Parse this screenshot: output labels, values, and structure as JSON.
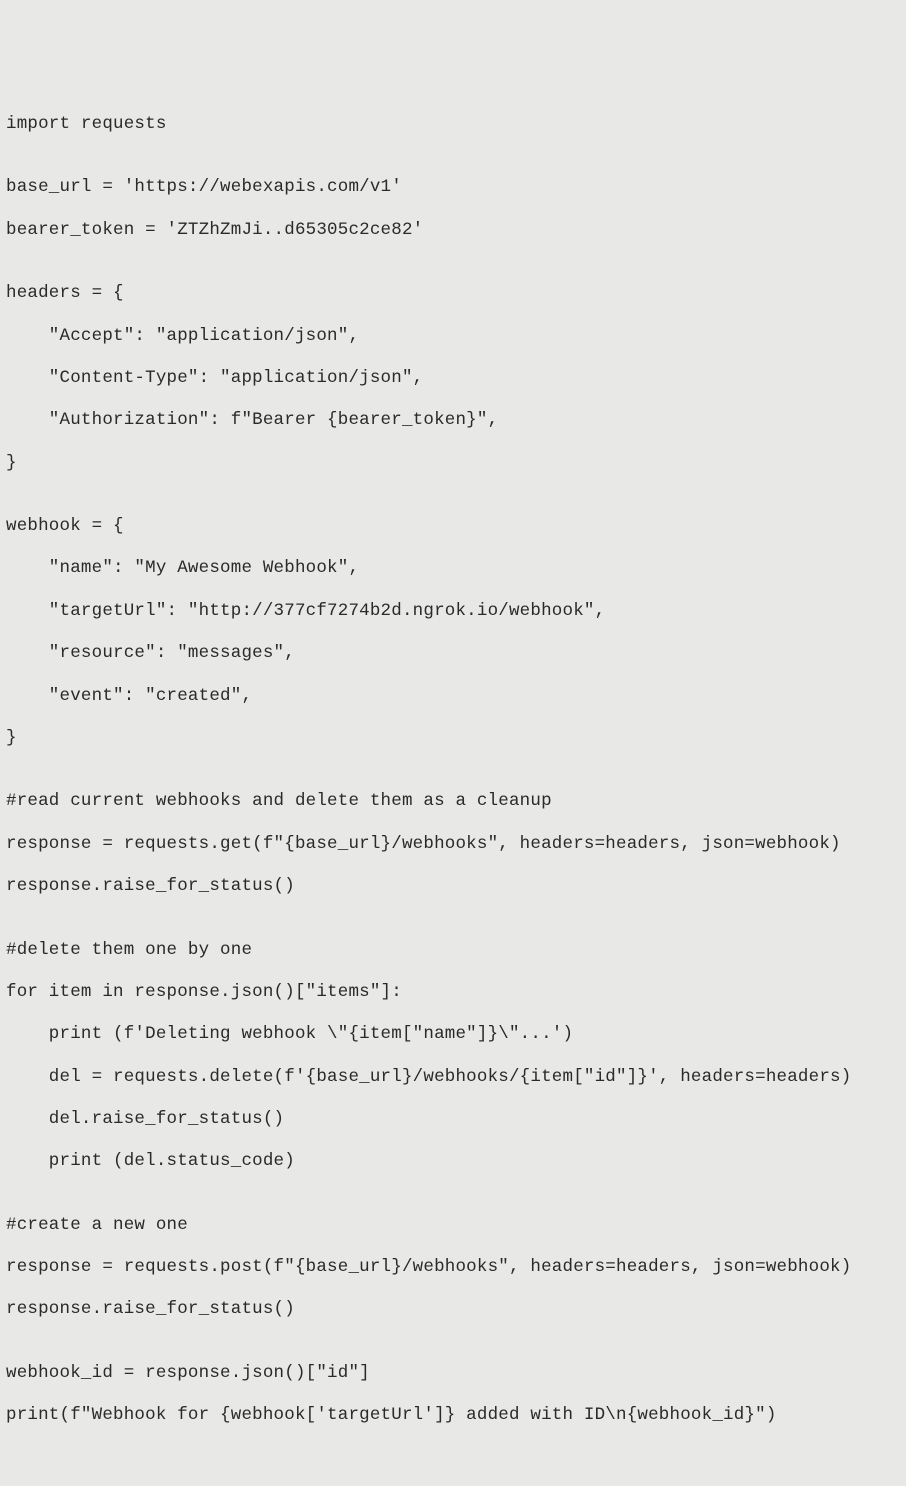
{
  "code": {
    "lines": [
      "import requests",
      "",
      "base_url = 'https://webexapis.com/v1'",
      "bearer_token = 'ZTZhZmJi..d65305c2ce82'",
      "",
      "headers = {",
      "    \"Accept\": \"application/json\",",
      "    \"Content-Type\": \"application/json\",",
      "    \"Authorization\": f\"Bearer {bearer_token}\",",
      "}",
      "",
      "webhook = {",
      "    \"name\": \"My Awesome Webhook\",",
      "    \"targetUrl\": \"http://377cf7274b2d.ngrok.io/webhook\",",
      "    \"resource\": \"messages\",",
      "    \"event\": \"created\",",
      "}",
      "",
      "#read current webhooks and delete them as a cleanup",
      "response = requests.get(f\"{base_url}/webhooks\", headers=headers, json=webhook)",
      "response.raise_for_status()",
      "",
      "#delete them one by one",
      "for item in response.json()[\"items\"]:",
      "    print (f'Deleting webhook \\\"{item[\"name\"]}\\\"...')",
      "    del = requests.delete(f'{base_url}/webhooks/{item[\"id\"]}', headers=headers)",
      "    del.raise_for_status()",
      "    print (del.status_code)",
      "",
      "#create a new one",
      "response = requests.post(f\"{base_url}/webhooks\", headers=headers, json=webhook)",
      "response.raise_for_status()",
      "",
      "webhook_id = response.json()[\"id\"]",
      "print(f\"Webhook for {webhook['targetUrl']} added with ID\\n{webhook_id}\")"
    ]
  }
}
